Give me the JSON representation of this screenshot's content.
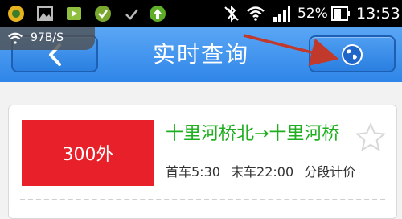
{
  "statusbar": {
    "battery_percent": "52%",
    "time": "13:53"
  },
  "netspeed": {
    "label": "97B/S"
  },
  "appbar": {
    "title": "实时查询"
  },
  "route": {
    "number": "300外",
    "stops": "十里河桥北→十里河桥",
    "first_bus": "首车5:30",
    "last_bus": "末车22:00",
    "fare": "分段计价"
  },
  "colors": {
    "appbar": "#3b8ff0",
    "badge": "#e8202a",
    "stops_text": "#1fae1f",
    "arrow": "#c0392b"
  }
}
